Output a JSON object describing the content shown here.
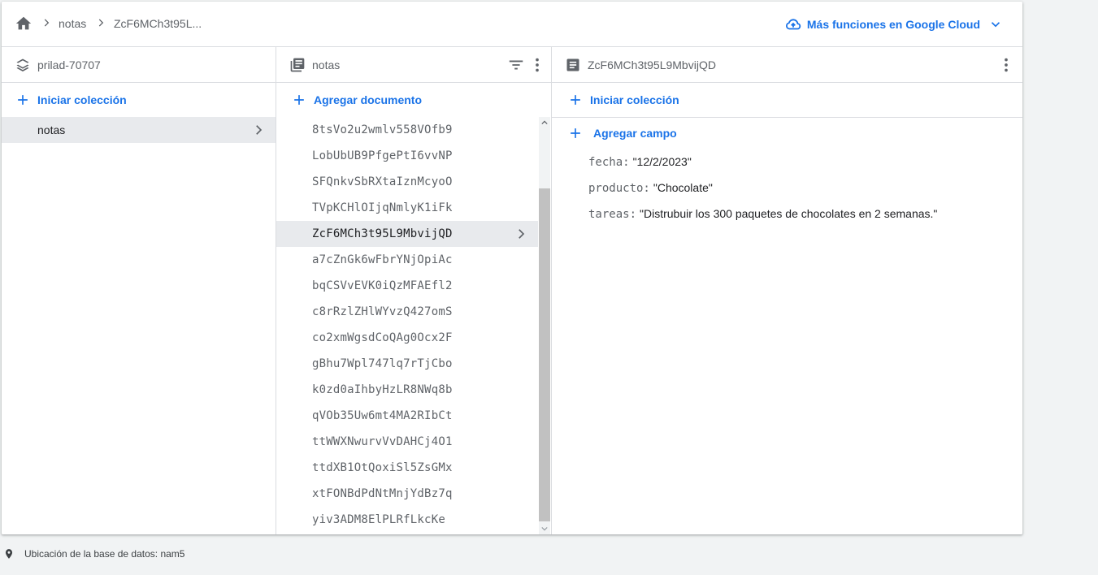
{
  "breadcrumb": {
    "items": [
      "notas",
      "ZcF6MCh3t95L..."
    ]
  },
  "google_cloud": {
    "label": "Más funciones en Google Cloud"
  },
  "col1": {
    "title": "prilad-70707",
    "action": "Iniciar colección",
    "collections": [
      "notas"
    ]
  },
  "col2": {
    "title": "notas",
    "action": "Agregar documento",
    "documents": [
      "8tsVo2u2wmlv558VOfb9",
      "LobUbUB9PfgePtI6vvNP",
      "SFQnkvSbRXtaIznMcyoO",
      "TVpKCHlOIjqNmlyK1iFk",
      "ZcF6MCh3t95L9MbvijQD",
      "a7cZnGk6wFbrYNjOpiAc",
      "bqCSVvEVK0iQzMFAEfl2",
      "c8rRzlZHlWYvzQ427omS",
      "co2xmWgsdCoQAg0Ocx2F",
      "gBhu7Wpl747lq7rTjCbo",
      "k0zd0aIhbyHzLR8NWq8b",
      "qVOb35Uw6mt4MA2RIbCt",
      "ttWWXNwurvVvDAHCj4O1",
      "ttdXB1OtQoxiSl5ZsGMx",
      "xtFONBdPdNtMnjYdBz7q",
      "yiv3ADM8ElPLRfLkcKe"
    ],
    "selected_index": 4
  },
  "col3": {
    "title": "ZcF6MCh3t95L9MbvijQD",
    "action_collection": "Iniciar colección",
    "action_field": "Agregar campo",
    "fields": [
      {
        "key": "fecha:",
        "value": "\"12/2/2023\""
      },
      {
        "key": "producto:",
        "value": "\"Chocolate\""
      },
      {
        "key": "tareas:",
        "value": "\"Distrubuir los 300 paquetes de chocolates en 2 semanas.\""
      }
    ]
  },
  "footer": {
    "location": "Ubicación de la base de datos: nam5"
  },
  "colors": {
    "accent": "#1a73e8",
    "selected_bg": "#e8eaed",
    "border": "#dadce0"
  }
}
